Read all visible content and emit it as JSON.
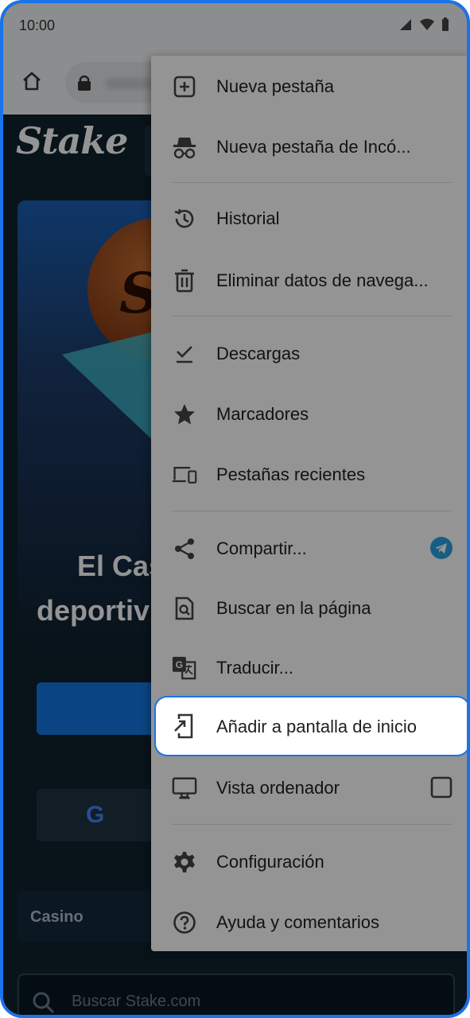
{
  "status_bar": {
    "time": "10:00",
    "icons": [
      "signal-icon",
      "wifi-icon",
      "battery-icon"
    ]
  },
  "toolbar": {
    "icons": [
      "home-icon",
      "lock-icon"
    ]
  },
  "page": {
    "logo": "Stake",
    "hero_line1": "El Cas",
    "hero_line2": "deportiv",
    "google_glyph": "G",
    "category_label": "Casino",
    "search_placeholder": "Buscar Stake.com"
  },
  "menu": {
    "items": [
      {
        "label": "Nueva pestaña",
        "icon": "new-tab-icon"
      },
      {
        "label": "Nueva pestaña de Incó...",
        "icon": "incognito-icon"
      },
      {
        "label": "Historial",
        "icon": "history-icon"
      },
      {
        "label": "Eliminar datos de navega...",
        "icon": "trash-icon"
      },
      {
        "label": "Descargas",
        "icon": "download-icon"
      },
      {
        "label": "Marcadores",
        "icon": "star-icon"
      },
      {
        "label": "Pestañas recientes",
        "icon": "devices-icon"
      },
      {
        "label": "Compartir...",
        "icon": "share-icon",
        "trailing": "telegram-icon"
      },
      {
        "label": "Buscar en la página",
        "icon": "find-in-page-icon"
      },
      {
        "label": "Traducir...",
        "icon": "translate-icon"
      },
      {
        "label": "Añadir a pantalla de inicio",
        "icon": "add-to-home-icon",
        "highlighted": true
      },
      {
        "label": "Vista ordenador",
        "icon": "desktop-icon",
        "trailing": "checkbox"
      },
      {
        "label": "Configuración",
        "icon": "settings-icon"
      },
      {
        "label": "Ayuda y comentarios",
        "icon": "help-icon"
      }
    ]
  },
  "colors": {
    "highlight_border": "#1a73e8",
    "telegram": "#2aa1e0",
    "stake_bg": "#0f212e"
  }
}
